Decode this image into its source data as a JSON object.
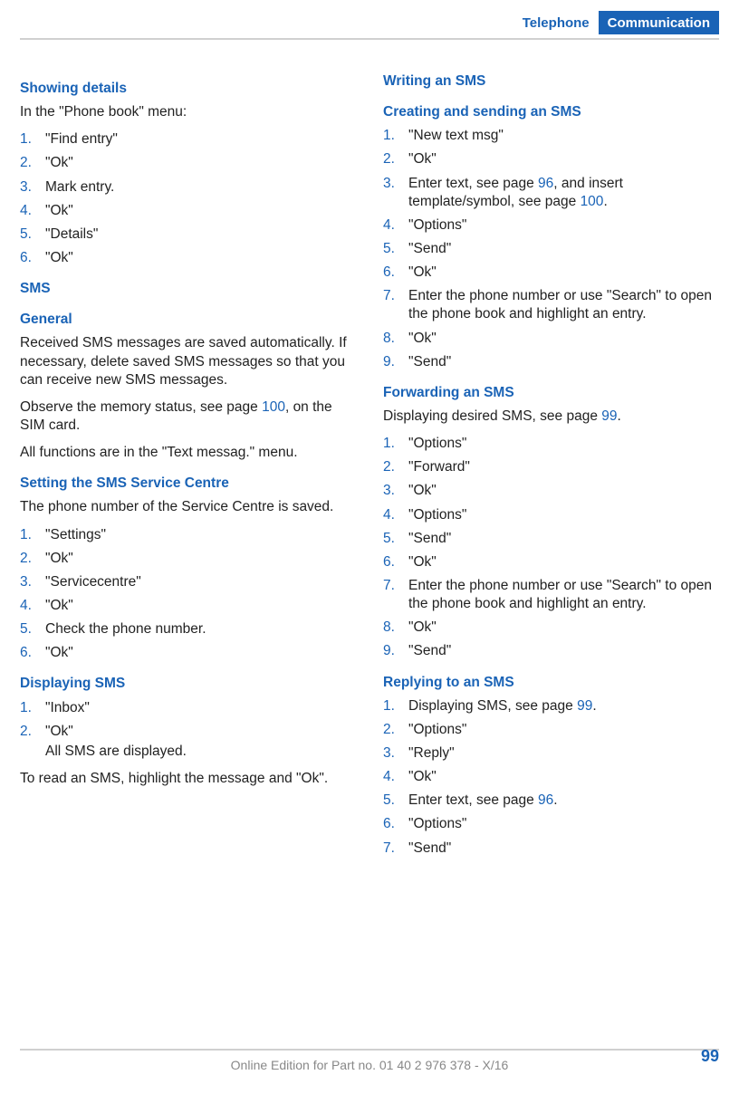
{
  "header": {
    "tab_inactive": "Telephone",
    "tab_active": "Communication"
  },
  "left": {
    "s1_title": "Showing details",
    "s1_intro": "In the \"Phone book\" menu:",
    "s1_steps": [
      "\"Find entry\"",
      "\"Ok\"",
      "Mark entry.",
      "\"Ok\"",
      "\"Details\"",
      "\"Ok\""
    ],
    "s2_title": "SMS",
    "s2a_title": "General",
    "s2a_p1": "Received SMS messages are saved automatically. If necessary, delete saved SMS messages so that you can receive new SMS messages.",
    "s2a_p2a": "Observe the memory status, see page ",
    "s2a_p2_link": "100",
    "s2a_p2b": ", on the SIM card.",
    "s2a_p3": "All functions are in the \"Text messag.\" menu.",
    "s2b_title": "Setting the SMS Service Centre",
    "s2b_p1": "The phone number of the Service Centre is saved.",
    "s2b_steps": [
      "\"Settings\"",
      "\"Ok\"",
      "\"Servicecentre\"",
      "\"Ok\"",
      "Check the phone number.",
      "\"Ok\""
    ],
    "s2c_title": "Displaying SMS",
    "s2c_steps": [
      "\"Inbox\"",
      "\"Ok\""
    ],
    "s2c_sub": "All SMS are displayed.",
    "s2c_p1": "To read an SMS, highlight the message and \"Ok\"."
  },
  "right": {
    "r1_title": "Writing an SMS",
    "r1a_title": "Creating and sending an SMS",
    "r1a_steps_pre": [
      "\"New text msg\"",
      "\"Ok\""
    ],
    "r1a_step3a": "Enter text, see page ",
    "r1a_step3_link1": "96",
    "r1a_step3b": ", and insert template/symbol, see page ",
    "r1a_step3_link2": "100",
    "r1a_step3c": ".",
    "r1a_steps_post": [
      "\"Options\"",
      "\"Send\"",
      "\"Ok\"",
      "Enter the phone number or use \"Search\" to open the phone book and highlight an entry.",
      "\"Ok\"",
      "\"Send\""
    ],
    "r1b_title": "Forwarding an SMS",
    "r1b_p1a": "Displaying desired SMS, see page ",
    "r1b_p1_link": "99",
    "r1b_p1b": ".",
    "r1b_steps": [
      "\"Options\"",
      "\"Forward\"",
      "\"Ok\"",
      "\"Options\"",
      "\"Send\"",
      "\"Ok\"",
      "Enter the phone number or use \"Search\" to open the phone book and highlight an entry.",
      "\"Ok\"",
      "\"Send\""
    ],
    "r1c_title": "Replying to an SMS",
    "r1c_step1a": "Displaying SMS, see page ",
    "r1c_step1_link": "99",
    "r1c_step1b": ".",
    "r1c_steps_234": [
      "\"Options\"",
      "\"Reply\"",
      "\"Ok\""
    ],
    "r1c_step5a": "Enter text, see page ",
    "r1c_step5_link": "96",
    "r1c_step5b": ".",
    "r1c_steps_67": [
      "\"Options\"",
      "\"Send\""
    ]
  },
  "footer": {
    "text": "Online Edition for Part no. 01 40 2 976 378 - X/16",
    "page_num": "99"
  }
}
